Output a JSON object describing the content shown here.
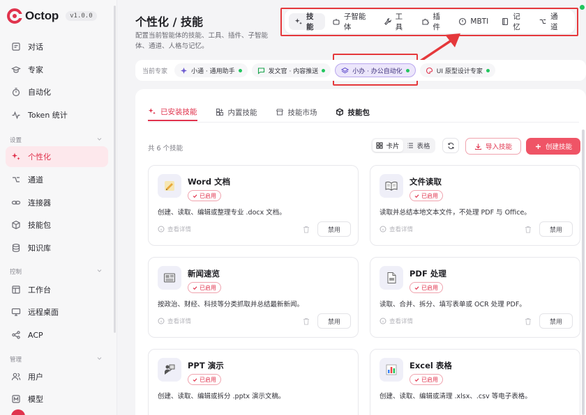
{
  "brand": {
    "name": "Octop",
    "version": "v1.0.0"
  },
  "sidebar": {
    "items": [
      {
        "label": "对话",
        "icon": "chat-icon"
      },
      {
        "label": "专家",
        "icon": "graduation-cap-icon"
      },
      {
        "label": "自动化",
        "icon": "timer-icon"
      },
      {
        "label": "Token 统计",
        "icon": "activity-icon"
      }
    ],
    "sections": [
      {
        "title": "设置",
        "items": [
          {
            "label": "个性化",
            "icon": "sparkles-icon",
            "active": true
          },
          {
            "label": "通道",
            "icon": "channel-icon"
          },
          {
            "label": "连接器",
            "icon": "link-icon"
          },
          {
            "label": "技能包",
            "icon": "package-icon"
          },
          {
            "label": "知识库",
            "icon": "database-icon"
          }
        ]
      },
      {
        "title": "控制",
        "items": [
          {
            "label": "工作台",
            "icon": "layout-icon"
          },
          {
            "label": "远程桌面",
            "icon": "monitor-icon"
          },
          {
            "label": "ACP",
            "icon": "share-nodes-icon"
          }
        ]
      },
      {
        "title": "管理",
        "items": [
          {
            "label": "用户",
            "icon": "users-icon"
          },
          {
            "label": "模型",
            "icon": "model-icon"
          }
        ]
      }
    ]
  },
  "header": {
    "title": "个性化 / 技能",
    "description": "配置当前智能体的技能、工具、插件、子智能体、通道、人格与记忆。"
  },
  "toolbar": {
    "tabs": [
      {
        "label": "技能",
        "icon": "sparkles-icon",
        "active": true
      },
      {
        "label": "子智能体",
        "icon": "bot-icon"
      },
      {
        "label": "工具",
        "icon": "wrench-icon"
      },
      {
        "label": "插件",
        "icon": "puzzle-icon"
      },
      {
        "label": "MBTI",
        "icon": "compass-icon"
      },
      {
        "label": "记忆",
        "icon": "book-icon"
      },
      {
        "label": "通道",
        "icon": "channel-icon"
      }
    ]
  },
  "experts": {
    "label": "当前专家",
    "chips": [
      {
        "label": "小通 · 通用助手",
        "icon": "sparkle-icon",
        "color": "#6d5bd0"
      },
      {
        "label": "发文官 · 内容推送",
        "icon": "message-icon",
        "color": "#16a34a"
      },
      {
        "label": "小办 · 办公自动化",
        "icon": "layers-icon",
        "color": "#6d5bd0",
        "selected": true
      },
      {
        "label": "UI 原型设计专家",
        "icon": "palette-icon",
        "color": "#e0334d"
      }
    ]
  },
  "content": {
    "tabs": [
      {
        "label": "已安装技能",
        "icon": "sparkles-icon",
        "active": true
      },
      {
        "label": "内置技能",
        "icon": "grid-plus-icon"
      },
      {
        "label": "技能市场",
        "icon": "store-icon"
      },
      {
        "label": "技能包",
        "icon": "package-icon",
        "bold": true
      }
    ],
    "count_label": "共 6 个技能",
    "view": {
      "card": "卡片",
      "table": "表格"
    },
    "import_label": "导入技能",
    "create_label": "创建技能",
    "status_label": "已启用",
    "detail_label": "查看详情",
    "disable_label": "禁用",
    "cards": [
      {
        "name": "Word 文档",
        "desc": "创建、读取、编辑或整理专业 .docx 文档。",
        "icon": "word-doc-icon"
      },
      {
        "name": "文件读取",
        "desc": "读取并总结本地文本文件，不处理 PDF 与 Office。",
        "icon": "open-book-icon"
      },
      {
        "name": "新闻速览",
        "desc": "按政治、财经、科技等分类抓取并总结最新新闻。",
        "icon": "newspaper-icon"
      },
      {
        "name": "PDF 处理",
        "desc": "读取、合并、拆分、填写表单或 OCR 处理 PDF。",
        "icon": "pdf-file-icon"
      },
      {
        "name": "PPT 演示",
        "desc": "创建、读取、编辑或拆分 .pptx 演示文稿。",
        "icon": "presenter-icon"
      },
      {
        "name": "Excel 表格",
        "desc": "创建、读取、编辑或清理 .xlsx、.csv 等电子表格。",
        "icon": "bar-chart-icon"
      }
    ]
  },
  "colors": {
    "accent": "#e0334d",
    "highlight": "#e5383b",
    "ok": "#22c55e"
  }
}
